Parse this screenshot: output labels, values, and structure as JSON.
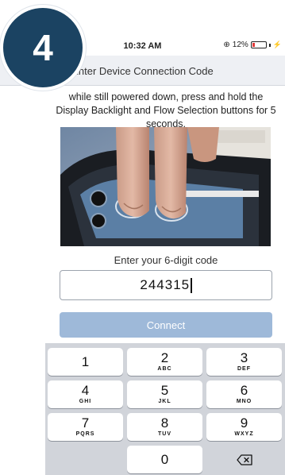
{
  "badge": {
    "number": "4"
  },
  "status_bar": {
    "time": "10:32 AM",
    "battery_percent": "12%"
  },
  "nav": {
    "title": "Enter Device Connection Code"
  },
  "instructions": {
    "text": "while still powered down, press and hold the Display Backlight and Flow Selection buttons for 5 seconds."
  },
  "form": {
    "code_label": "Enter your 6-digit code",
    "code_value": "244315",
    "connect_label": "Connect"
  },
  "keyboard": {
    "keys": [
      {
        "digit": "1",
        "letters": ""
      },
      {
        "digit": "2",
        "letters": "ABC"
      },
      {
        "digit": "3",
        "letters": "DEF"
      },
      {
        "digit": "4",
        "letters": "GHI"
      },
      {
        "digit": "5",
        "letters": "JKL"
      },
      {
        "digit": "6",
        "letters": "MNO"
      },
      {
        "digit": "7",
        "letters": "PQRS"
      },
      {
        "digit": "8",
        "letters": "TUV"
      },
      {
        "digit": "9",
        "letters": "WXYZ"
      },
      {
        "digit": "0",
        "letters": ""
      }
    ],
    "delete_icon": "backspace-icon"
  },
  "colors": {
    "badge": "#1b4362",
    "connect_disabled": "#9eb9d9",
    "nav_background": "#eef0f4",
    "keyboard_background": "#d1d4da"
  }
}
